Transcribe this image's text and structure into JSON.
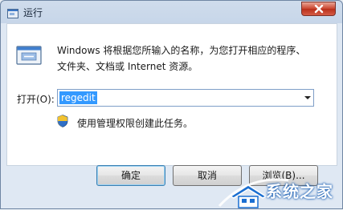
{
  "window": {
    "title": "运行"
  },
  "description": {
    "line1": "Windows 将根据您所输入的名称，为您打开相应的程序、",
    "line2": "文件夹、文档或 Internet 资源。"
  },
  "open_field": {
    "label": "打开(O):",
    "value": "regedit"
  },
  "admin_note": "使用管理权限创建此任务。",
  "buttons": {
    "ok": "确定",
    "cancel": "取消",
    "browse": "浏览(B)..."
  },
  "watermark": {
    "text": "系统之家"
  },
  "icons": {
    "title": "run-icon",
    "close": "close-icon",
    "main": "run-program-icon",
    "shield": "uac-shield-icon",
    "dropdown": "chevron-down-icon"
  }
}
